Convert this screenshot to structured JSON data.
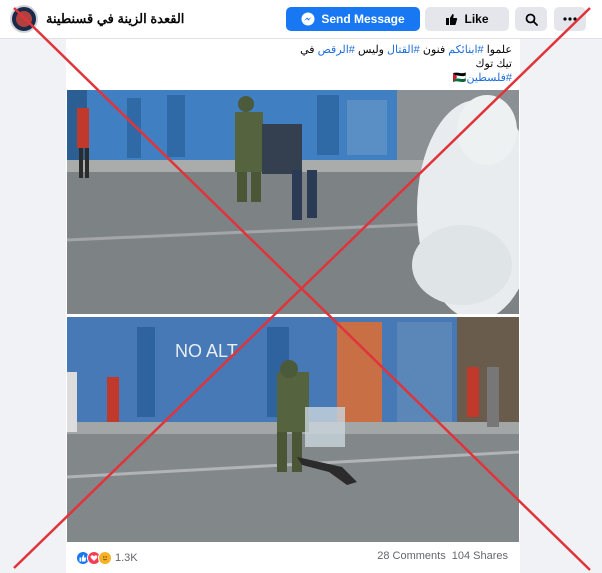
{
  "header": {
    "page_name": "القعدة الزينة في قسنطينة",
    "send_message_label": "Send Message",
    "like_label": "Like"
  },
  "post": {
    "line1_prefix": "علموا ",
    "tag1": "#ابنائكم",
    "line1_mid": " فنون ",
    "tag2": "#القتال",
    "line1_mid2": " وليس ",
    "tag3": "#الرقص",
    "line1_suffix": " في",
    "line2": "تيك توك",
    "tag4": "#فلسطين",
    "flag": "🇵🇸"
  },
  "footer": {
    "reaction_count": "1.3K",
    "comments": "28 Comments",
    "shares": "104 Shares"
  },
  "colors": {
    "brand_blue": "#1877f2",
    "hashtag_blue": "#216fdb",
    "overlay_red": "#e0343b"
  },
  "icons": [
    "messenger-icon",
    "thumbs-up-icon",
    "search-icon",
    "more-icon",
    "like-reaction-icon",
    "love-reaction-icon",
    "care-reaction-icon"
  ]
}
